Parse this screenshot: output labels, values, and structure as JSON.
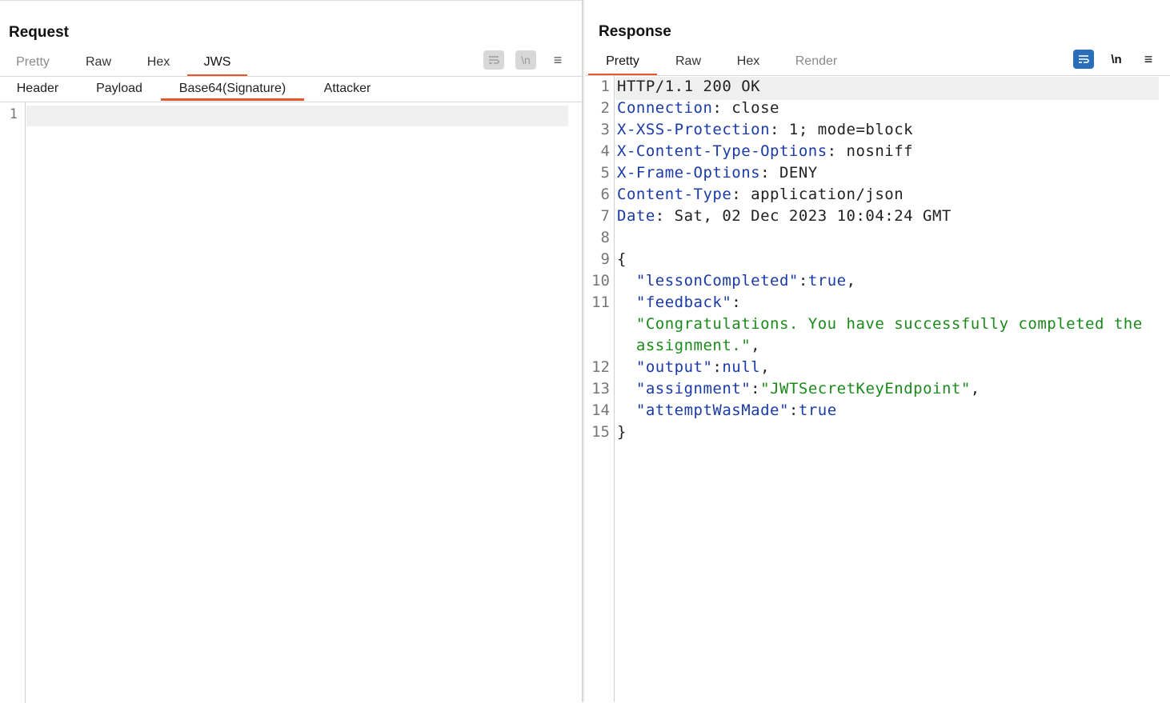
{
  "request": {
    "title": "Request",
    "tabs": [
      {
        "label": "Pretty"
      },
      {
        "label": "Raw"
      },
      {
        "label": "Hex"
      },
      {
        "label": "JWS"
      }
    ],
    "subtabs": [
      {
        "label": "Header"
      },
      {
        "label": "Payload"
      },
      {
        "label": "Base64(Signature)"
      },
      {
        "label": "Attacker"
      }
    ],
    "line_numbers": [
      "1"
    ],
    "toolbar": {
      "wrap_icon": "wrap-lines-icon",
      "newline_label": "\\n",
      "menu_icon": "hamburger-menu-icon"
    }
  },
  "response": {
    "title": "Response",
    "tabs": [
      {
        "label": "Pretty"
      },
      {
        "label": "Raw"
      },
      {
        "label": "Hex"
      },
      {
        "label": "Render"
      }
    ],
    "toolbar": {
      "wrap_icon": "wrap-lines-icon",
      "newline_label": "\\n",
      "menu_icon": "hamburger-menu-icon"
    },
    "lines": [
      {
        "n": "1",
        "parts": [
          [
            "v",
            "HTTP/1.1 200 OK"
          ]
        ]
      },
      {
        "n": "2",
        "parts": [
          [
            "k",
            "Connection"
          ],
          [
            "p",
            ": close"
          ]
        ]
      },
      {
        "n": "3",
        "parts": [
          [
            "k",
            "X-XSS-Protection"
          ],
          [
            "p",
            ": 1; mode=block"
          ]
        ]
      },
      {
        "n": "4",
        "parts": [
          [
            "k",
            "X-Content-Type-Options"
          ],
          [
            "p",
            ": nosniff"
          ]
        ]
      },
      {
        "n": "5",
        "parts": [
          [
            "k",
            "X-Frame-Options"
          ],
          [
            "p",
            ": DENY"
          ]
        ]
      },
      {
        "n": "6",
        "parts": [
          [
            "k",
            "Content-Type"
          ],
          [
            "p",
            ": application/json"
          ]
        ]
      },
      {
        "n": "7",
        "parts": [
          [
            "k",
            "Date"
          ],
          [
            "p",
            ": Sat, 02 Dec 2023 10:04:24 GMT"
          ]
        ]
      },
      {
        "n": "8",
        "parts": []
      },
      {
        "n": "9",
        "parts": [
          [
            "p",
            "{"
          ]
        ]
      },
      {
        "n": "10",
        "parts": [
          [
            "p",
            "  "
          ],
          [
            "k",
            "\"lessonCompleted\""
          ],
          [
            "p",
            ":"
          ],
          [
            "k",
            "true"
          ],
          [
            "p",
            ","
          ]
        ]
      },
      {
        "n": "11",
        "parts": [
          [
            "p",
            "  "
          ],
          [
            "k",
            "\"feedback\""
          ],
          [
            "p",
            ":"
          ]
        ]
      },
      {
        "n": "",
        "parts": [
          [
            "p",
            "  "
          ],
          [
            "s",
            "\"Congratulations. You have successfully completed the"
          ]
        ]
      },
      {
        "n": "",
        "parts": [
          [
            "p",
            "  "
          ],
          [
            "s",
            "assignment.\""
          ],
          [
            "p",
            ","
          ]
        ]
      },
      {
        "n": "12",
        "parts": [
          [
            "p",
            "  "
          ],
          [
            "k",
            "\"output\""
          ],
          [
            "p",
            ":"
          ],
          [
            "k",
            "null"
          ],
          [
            "p",
            ","
          ]
        ]
      },
      {
        "n": "13",
        "parts": [
          [
            "p",
            "  "
          ],
          [
            "k",
            "\"assignment\""
          ],
          [
            "p",
            ":"
          ],
          [
            "s",
            "\"JWTSecretKeyEndpoint\""
          ],
          [
            "p",
            ","
          ]
        ]
      },
      {
        "n": "14",
        "parts": [
          [
            "p",
            "  "
          ],
          [
            "k",
            "\"attemptWasMade\""
          ],
          [
            "p",
            ":"
          ],
          [
            "k",
            "true"
          ]
        ]
      },
      {
        "n": "15",
        "parts": [
          [
            "p",
            "}"
          ]
        ]
      }
    ]
  },
  "layout_buttons": [
    {
      "icon": "split-horizontal-icon",
      "active": true
    },
    {
      "icon": "split-vertical-icon",
      "active": false
    },
    {
      "icon": "single-pane-icon",
      "active": false
    }
  ],
  "colors": {
    "accent": "#e8562a",
    "key": "#1a3aa8",
    "string": "#1a8a1a",
    "active_button": "#2a6ebb"
  }
}
